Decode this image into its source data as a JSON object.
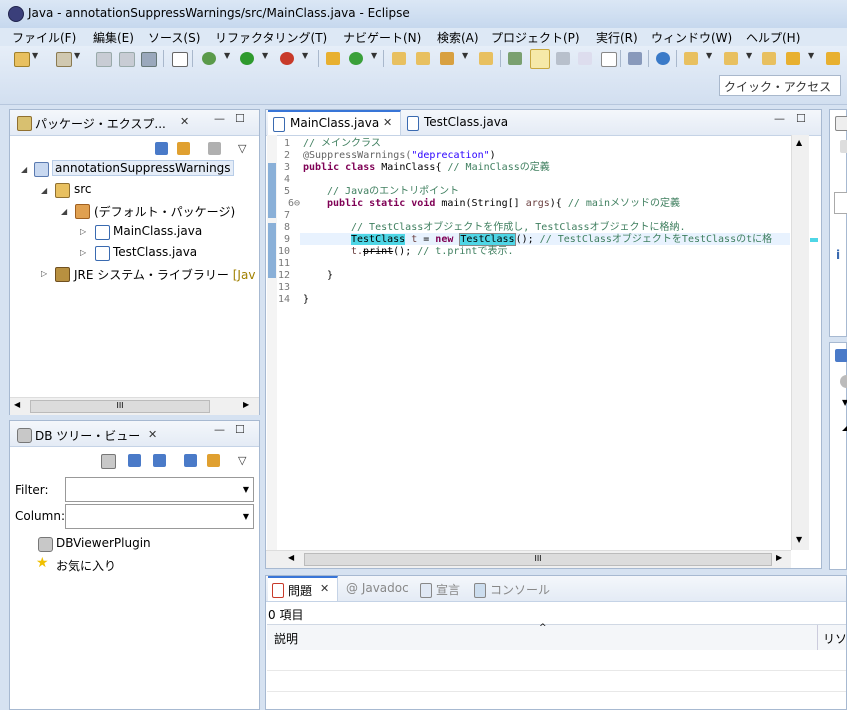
{
  "window": {
    "title": "Java - annotationSuppressWarnings/src/MainClass.java - Eclipse"
  },
  "menu": [
    "ファイル(F)",
    "編集(E)",
    "ソース(S)",
    "リファクタリング(T)",
    "ナビゲート(N)",
    "検索(A)",
    "プロジェクト(P)",
    "実行(R)",
    "ウィンドウ(W)",
    "ヘルプ(H)"
  ],
  "toolbar": {
    "quick_access_placeholder": "クイック・アクセス"
  },
  "package_explorer": {
    "tab_label": "パッケージ・エクスプ...",
    "tree": {
      "project": "annotationSuppressWarnings",
      "src": "src",
      "default_package": "(デフォルト・パッケージ)",
      "file1": "MainClass.java",
      "file2": "TestClass.java",
      "jre": "JRE システム・ライブラリー",
      "jre_suffix": "[Jav"
    },
    "scroll_thumb": "III"
  },
  "db_tree": {
    "tab_label": "DB ツリー・ビュー",
    "filter_label": "Filter:",
    "column_label": "Column:",
    "items": [
      "DBViewerPlugin",
      "お気に入り"
    ]
  },
  "editor": {
    "tabs": [
      "MainClass.java",
      "TestClass.java"
    ],
    "line_numbers": [
      "1",
      "2",
      "3",
      "4",
      "5",
      "6⊖",
      "7",
      "8",
      "9",
      "10",
      "11",
      "12",
      "13",
      "14"
    ],
    "lines": {
      "l1": "// メインクラス",
      "l2a": "@SuppressWarnings(",
      "l2b": "\"deprecation\"",
      "l2c": ")",
      "l3a": "public class",
      "l3b": " MainClass{ ",
      "l3c": "// MainClassの定義",
      "l5": "// Javaのエントリポイント",
      "l6a": "public static void",
      "l6b": " main(String[] ",
      "l6c": "args",
      "l6d": "){ ",
      "l6e": "// mainメソッドの定義",
      "l8": "// TestClassオブジェクトを作成し, TestClassオブジェクトに格納.",
      "l9a": "TestClass",
      "l9b": " t",
      "l9c": " = ",
      "l9d": "new",
      "l9e": "TestClass",
      "l9f": "(); ",
      "l9g": "// TestClassオブジェクトをTestClassのtに格",
      "l10a": "t.",
      "l10b": "print",
      "l10c": "(); ",
      "l10d": "// t.printで表示.",
      "l12": "}",
      "l14": "}"
    },
    "scroll_thumb": "III"
  },
  "problems": {
    "tabs": [
      "問題",
      "@ Javadoc",
      "宣言",
      "コンソール"
    ],
    "count": "0 項目",
    "columns": [
      "説明",
      "リソ"
    ]
  },
  "colors": {
    "accent": "#3875d7",
    "highlight": "#4fd6e6"
  }
}
